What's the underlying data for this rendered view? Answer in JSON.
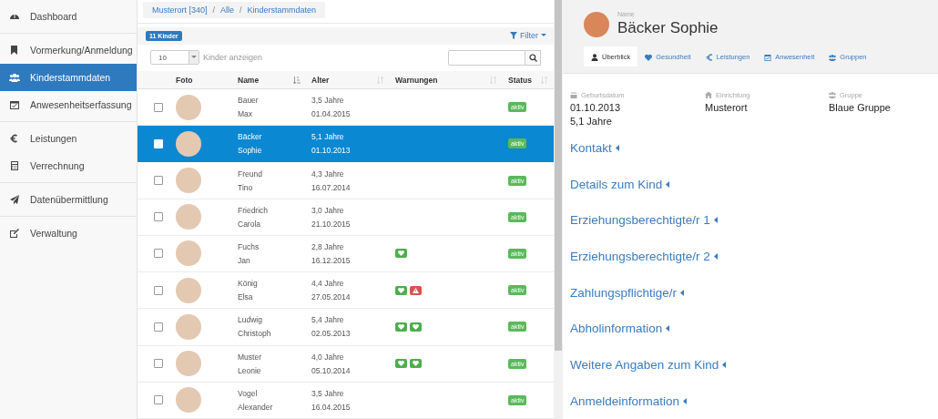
{
  "sidebar": {
    "groups": [
      {
        "items": [
          {
            "label": "Dashboard",
            "selected": false
          }
        ]
      },
      {
        "items": [
          {
            "label": "Vormerkung/Anmeldung",
            "selected": false
          },
          {
            "label": "Kinderstammdaten",
            "selected": true
          },
          {
            "label": "Anwesenheitserfassung",
            "selected": false
          }
        ]
      },
      {
        "items": [
          {
            "label": "Leistungen",
            "selected": false
          },
          {
            "label": "Verrechnung",
            "selected": false
          }
        ]
      },
      {
        "items": [
          {
            "label": "Datenübermittlung",
            "selected": false
          }
        ]
      },
      {
        "items": [
          {
            "label": "Verwaltung",
            "selected": false
          }
        ]
      }
    ]
  },
  "breadcrumb": [
    {
      "kind": "link",
      "text": "Musterort [340]"
    },
    {
      "kind": "separator",
      "text": "/"
    },
    {
      "kind": "link",
      "text": "Alle"
    },
    {
      "kind": "separator",
      "text": "/"
    },
    {
      "kind": "link",
      "text": "Kinderstammdaten"
    }
  ],
  "count_badge": "11 Kinder",
  "filter": {
    "label": "Filter"
  },
  "page_size": {
    "value": "10",
    "label": "Kinder anzeigen"
  },
  "table": {
    "columns": [
      {},
      {
        "label": "Foto"
      },
      {
        "label": "Name",
        "sorted": true
      },
      {
        "label": "Alter",
        "sorted": false
      },
      {
        "label": "Warnungen",
        "sorted": false
      },
      {
        "label": "Status",
        "sorted": false
      }
    ],
    "rows": [
      {
        "selected": false,
        "last": "Bauer",
        "first": "Max",
        "age": "3,5 Jahre",
        "dob": "01.04.2015",
        "warnings": [],
        "status": "aktiv"
      },
      {
        "selected": true,
        "last": "Bäcker",
        "first": "Sophie",
        "age": "5,1 Jahre",
        "dob": "01.10.2013",
        "warnings": [],
        "status": "aktiv"
      },
      {
        "selected": false,
        "last": "Freund",
        "first": "Tino",
        "age": "4,3 Jahre",
        "dob": "16.07.2014",
        "warnings": [],
        "status": "aktiv"
      },
      {
        "selected": false,
        "last": "Friedrich",
        "first": "Carola",
        "age": "3,0 Jahre",
        "dob": "21.10.2015",
        "warnings": [],
        "status": "aktiv"
      },
      {
        "selected": false,
        "last": "Fuchs",
        "first": "Jan",
        "age": "2,8 Jahre",
        "dob": "16.12.2015",
        "warnings": [
          {
            "kind": "health"
          }
        ],
        "status": "aktiv"
      },
      {
        "selected": false,
        "last": "König",
        "first": "Elsa",
        "age": "4,4 Jahre",
        "dob": "27.05.2014",
        "warnings": [
          {
            "kind": "health"
          },
          {
            "kind": "alert"
          }
        ],
        "status": "aktiv"
      },
      {
        "selected": false,
        "last": "Ludwig",
        "first": "Christoph",
        "age": "5,4 Jahre",
        "dob": "02.05.2013",
        "warnings": [
          {
            "kind": "health"
          },
          {
            "kind": "health"
          }
        ],
        "status": "aktiv"
      },
      {
        "selected": false,
        "last": "Muster",
        "first": "Leonie",
        "age": "4,0 Jahre",
        "dob": "05.10.2014",
        "warnings": [
          {
            "kind": "health"
          },
          {
            "kind": "health"
          }
        ],
        "status": "aktiv"
      },
      {
        "selected": false,
        "last": "Vogel",
        "first": "Alexander",
        "age": "3,5 Jahre",
        "dob": "16.04.2015",
        "warnings": [],
        "status": "aktiv"
      }
    ]
  },
  "detail": {
    "name_label": "Name",
    "name": "Bäcker Sophie",
    "tabs": [
      {
        "label": "Überblick",
        "selected": true
      },
      {
        "label": "Gesundheit",
        "selected": false
      },
      {
        "label": "Leistungen",
        "selected": false
      },
      {
        "label": "Anwesenheit",
        "selected": false
      },
      {
        "label": "Gruppen",
        "selected": false
      }
    ],
    "facts": [
      {
        "label": "Geburtsdatum",
        "values": [
          "01.10.2013",
          "5,1 Jahre"
        ]
      },
      {
        "label": "Einrichtung",
        "values": [
          "Musterort"
        ]
      },
      {
        "label": "Gruppe",
        "values": [
          "Blaue Gruppe"
        ]
      }
    ],
    "sections": [
      {
        "label": "Kontakt",
        "expanded": false
      },
      {
        "label": "Details zum Kind",
        "expanded": false
      },
      {
        "label": "Erziehungsberechtigte/r 1",
        "expanded": false
      },
      {
        "label": "Erziehungsberechtigte/r 2",
        "expanded": false
      },
      {
        "label": "Zahlungspflichtige/r",
        "expanded": false
      },
      {
        "label": "Abholinformation",
        "expanded": false
      },
      {
        "label": "Weitere Angaben zum Kind",
        "expanded": false
      },
      {
        "label": "Anmeldeinformation",
        "expanded": false
      }
    ]
  }
}
